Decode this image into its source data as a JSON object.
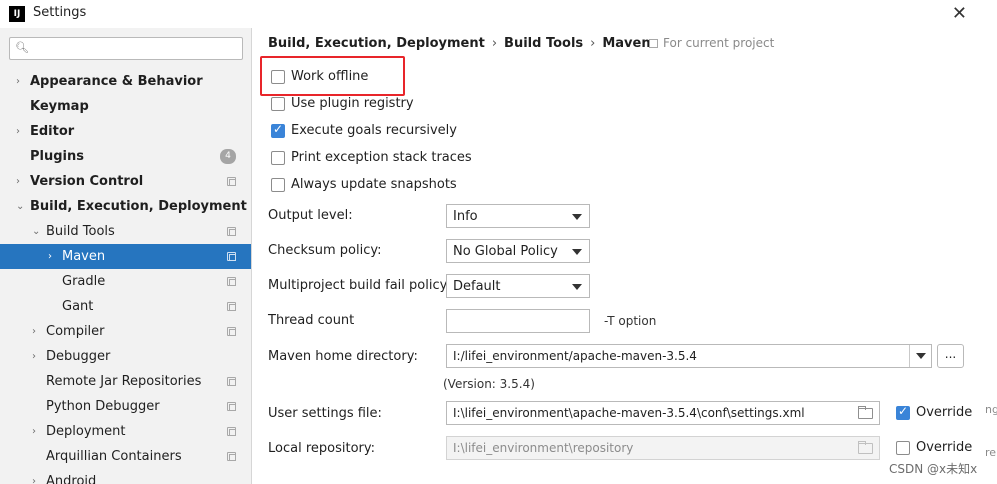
{
  "window": {
    "title": "Settings",
    "app_icon_text": "IJ",
    "close_glyph": "✕"
  },
  "search": {
    "placeholder": "",
    "icon": "search-icon"
  },
  "sidebar": {
    "items": [
      {
        "label": "Appearance & Behavior",
        "expandable": true,
        "bold": true,
        "indent": 0
      },
      {
        "label": "Keymap",
        "expandable": false,
        "bold": true,
        "indent": 0
      },
      {
        "label": "Editor",
        "expandable": true,
        "bold": true,
        "indent": 0
      },
      {
        "label": "Plugins",
        "expandable": false,
        "bold": true,
        "indent": 0,
        "badge": "4"
      },
      {
        "label": "Version Control",
        "expandable": true,
        "bold": true,
        "indent": 0,
        "project": true
      },
      {
        "label": "Build, Execution, Deployment",
        "expandable": true,
        "expanded": true,
        "bold": true,
        "indent": 0
      },
      {
        "label": "Build Tools",
        "expandable": true,
        "expanded": true,
        "bold": false,
        "indent": 1,
        "project": true
      },
      {
        "label": "Maven",
        "expandable": true,
        "bold": false,
        "indent": 2,
        "project": true,
        "selected": true
      },
      {
        "label": "Gradle",
        "expandable": false,
        "bold": false,
        "indent": 2,
        "project": true
      },
      {
        "label": "Gant",
        "expandable": false,
        "bold": false,
        "indent": 2,
        "project": true
      },
      {
        "label": "Compiler",
        "expandable": true,
        "bold": false,
        "indent": 1,
        "project": true
      },
      {
        "label": "Debugger",
        "expandable": true,
        "bold": false,
        "indent": 1
      },
      {
        "label": "Remote Jar Repositories",
        "expandable": false,
        "bold": false,
        "indent": 1,
        "project": true
      },
      {
        "label": "Python Debugger",
        "expandable": false,
        "bold": false,
        "indent": 1,
        "project": true
      },
      {
        "label": "Deployment",
        "expandable": true,
        "bold": false,
        "indent": 1,
        "project": true
      },
      {
        "label": "Arquillian Containers",
        "expandable": false,
        "bold": false,
        "indent": 1,
        "project": true
      },
      {
        "label": "Android",
        "expandable": true,
        "bold": false,
        "indent": 1
      }
    ]
  },
  "breadcrumb": {
    "parts": [
      "Build, Execution, Deployment",
      "Build Tools",
      "Maven"
    ],
    "separator": "›",
    "scope": "For current project"
  },
  "checkboxes": [
    {
      "label": "Work offline",
      "checked": false
    },
    {
      "label": "Use plugin registry",
      "checked": false
    },
    {
      "label": "Execute goals recursively",
      "checked": true
    },
    {
      "label": "Print exception stack traces",
      "checked": false
    },
    {
      "label": "Always update snapshots",
      "checked": false
    }
  ],
  "fields": {
    "output_level": {
      "label": "Output level:",
      "value": "Info"
    },
    "checksum_policy": {
      "label": "Checksum policy:",
      "value": "No Global Policy"
    },
    "fail_policy": {
      "label": "Multiproject build fail policy:",
      "value": "Default"
    },
    "thread_count": {
      "label": "Thread count",
      "value": "",
      "hint": "-T option"
    },
    "maven_home": {
      "label": "Maven home directory:",
      "value": "I:/lifei_environment/apache-maven-3.5.4",
      "browse": "...",
      "version": "(Version: 3.5.4)"
    },
    "user_settings": {
      "label": "User settings file:",
      "value": "I:\\lifei_environment\\apache-maven-3.5.4\\conf\\settings.xml",
      "override_label": "Override",
      "override_checked": true
    },
    "local_repo": {
      "label": "Local repository:",
      "value": "I:\\lifei_environment\\repository",
      "override_label": "Override",
      "override_checked": false
    }
  },
  "watermark": "CSDN @x未知x",
  "edge_fragments": [
    "ng",
    "re"
  ],
  "colors": {
    "selection": "#2675bf",
    "checkbox_on": "#3a84d8",
    "highlight_box": "#e8252a"
  }
}
